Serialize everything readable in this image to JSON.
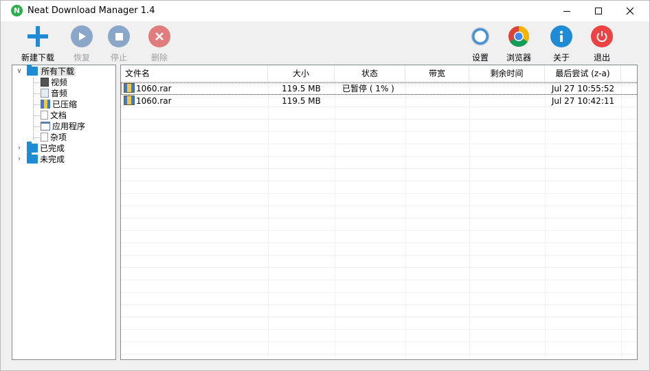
{
  "window": {
    "title": "Neat Download Manager 1.4",
    "app_icon": "N"
  },
  "toolbar": {
    "new_download": "新建下载",
    "resume": "恢复",
    "stop": "停止",
    "delete": "删除",
    "settings": "设置",
    "browser": "浏览器",
    "about": "关于",
    "exit": "退出"
  },
  "tree": {
    "all_downloads": "所有下载",
    "children": [
      "视频",
      "音频",
      "已压缩",
      "文档",
      "应用程序",
      "杂项"
    ],
    "completed": "已完成",
    "incomplete": "未完成"
  },
  "list": {
    "columns": [
      "文件名",
      "大小",
      "状态",
      "带宽",
      "剩余时间",
      "最后尝试 (z-a)"
    ],
    "rows": [
      {
        "name": "1060.rar",
        "size": "119.5 MB",
        "status": "已暂停 ( 1% )",
        "bandwidth": "",
        "remaining": "",
        "last_try": "Jul 27 10:55:52"
      },
      {
        "name": "1060.rar",
        "size": "119.5 MB",
        "status": "",
        "bandwidth": "",
        "remaining": "",
        "last_try": "Jul 27 10:42:11"
      }
    ]
  },
  "colors": {
    "accent_blue": "#1e8bd6",
    "delete_red": "#e35b5b",
    "exit_red": "#ec4242",
    "app_green": "#2bb04c"
  }
}
